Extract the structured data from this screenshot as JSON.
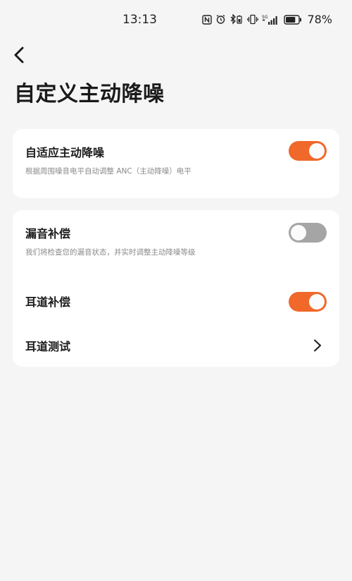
{
  "status_bar": {
    "time": "13:13",
    "battery_percent": "78%",
    "battery_level": 0.78,
    "network_label": "5G"
  },
  "header": {
    "title": "自定义主动降噪"
  },
  "settings": {
    "adaptive_anc": {
      "title": "自适应主动降噪",
      "subtitle": "根据周围噪音电平自动调整 ANC（主动降噪）电平",
      "enabled": true
    },
    "leak_compensation": {
      "title": "漏音补偿",
      "subtitle": "我们将检查您的漏音状态，并实时调整主动降噪等级",
      "enabled": false
    },
    "ear_canal_compensation": {
      "title": "耳道补偿",
      "enabled": true
    },
    "ear_canal_test": {
      "title": "耳道测试"
    }
  },
  "colors": {
    "accent": "#f0682a",
    "toggle_off": "#a5a5a5",
    "background": "#f5f5f5",
    "card": "#ffffff"
  }
}
